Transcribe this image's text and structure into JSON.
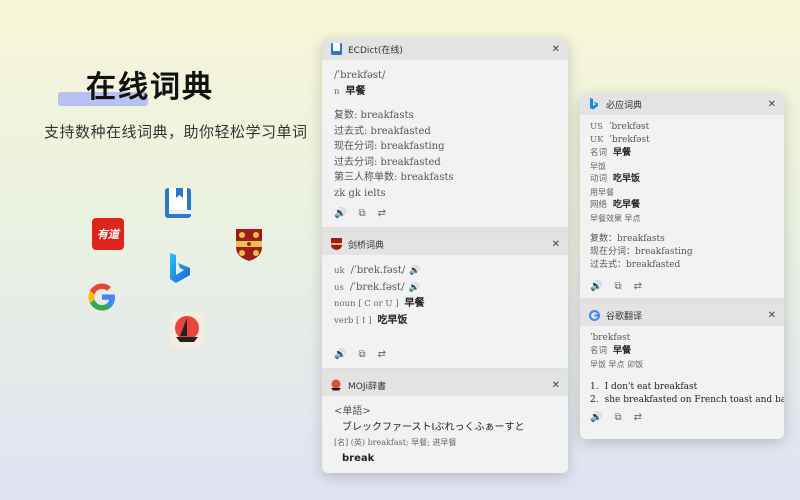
{
  "hero": {
    "title": "在线词典",
    "subtitle": "支持数种在线词典，助你轻松学习单词"
  },
  "logos": [
    "youdao",
    "ecdict-book",
    "bing",
    "cambridge",
    "google",
    "moji"
  ],
  "ecdict": {
    "name": "ECDict(在线)",
    "phonetic": "/ˈbrekfəst/",
    "pos": "n",
    "meaning": "早餐",
    "forms": [
      "复数: breakfasts",
      "过去式: breakfasted",
      "现在分词: breakfasting",
      "过去分词: breakfasted",
      "第三人称单数: breakfasts"
    ],
    "tags": "zk gk ielts"
  },
  "cambridge": {
    "name": "剑桥词典",
    "uk_label": "uk",
    "uk_phonetic": "/ˈbrek.fəst/",
    "us_label": "us",
    "us_phonetic": "/ˈbrek.fəst/",
    "noun_pos": "noun [ C or U ]",
    "noun_meaning": "早餐",
    "verb_pos": "verb [ I ]",
    "verb_meaning": "吃早饭"
  },
  "moji": {
    "name": "MOJi辞書",
    "tag": "<单語>",
    "reading": "ブレックファーストⅠぶれっくふぁーすと",
    "def": "[名] (英) breakfast; 早餐; 进早餐",
    "word": "break"
  },
  "bing": {
    "name": "必应词典",
    "us_label": "US",
    "us_phonetic": "ˈbrekfəst",
    "uk_label": "UK",
    "uk_phonetic": "ˈbrekfəst",
    "noun_label": "名词",
    "noun_meaning": "早餐",
    "noun_sub": "早饭",
    "verb_label": "动词",
    "verb_meaning": "吃早饭",
    "verb_sub": "用早餐",
    "net_label": "网络",
    "net_meaning": "吃早餐",
    "net_sub": "早餐效果 早点",
    "plural": "复数：breakfasts",
    "present": "现在分词：breakfasting",
    "past": "过去式：breakfasted"
  },
  "google": {
    "name": "谷歌翻译",
    "phonetic": "ˈbrekfəst",
    "noun_label": "名词",
    "noun_meaning": "早餐",
    "noun_sub": "早饭 早点 卯饭",
    "ex1_num": "1.",
    "ex1": "I don't eat breakfast",
    "ex2_num": "2.",
    "ex2": "she breakfasted on French toast and bacon"
  },
  "ui": {
    "collapse": "✕",
    "speaker": "🔊",
    "copy": "⧉",
    "swap": "⇄"
  }
}
